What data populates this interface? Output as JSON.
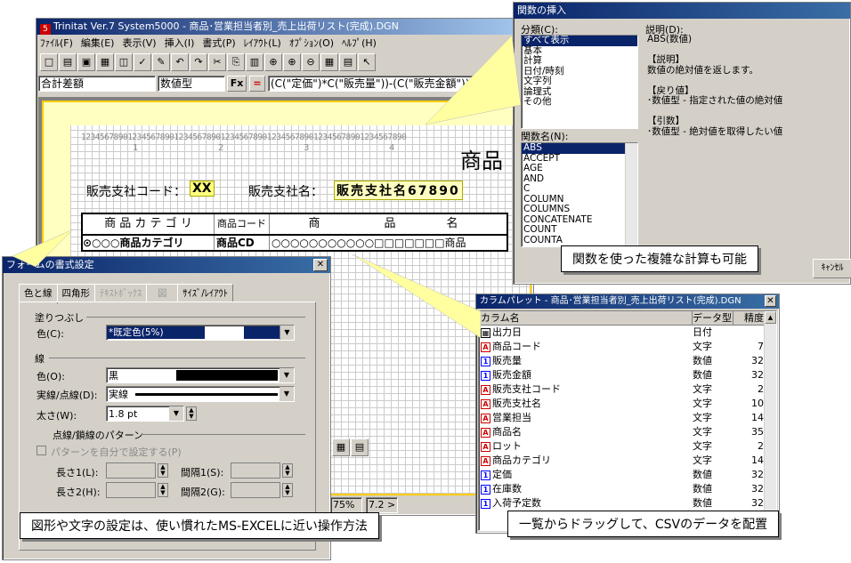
{
  "main": {
    "title": "Trinitat Ver.7 System5000 - 商品･営業担当者別_売上出荷リスト(完成).DGN",
    "menu": [
      "ﾌｧｲﾙ(F)",
      "編集(E)",
      "表示(V)",
      "挿入(I)",
      "書式(P)",
      "ﾚｲｱｳﾄ(L)",
      "ｵﾌﾟｼｮﾝ(O)",
      "ﾍﾙﾌﾟ(H)"
    ],
    "formula_name": "合計差額",
    "formula_type": "数値型",
    "fx": "Fx",
    "eq": "=",
    "formula": "(C(\"定価\")*C(\"販売量\"))-(C(\"販売金額\"))",
    "ruler": "1234567890123456789012345678901234567890123456789012345678901234567890",
    "ruler_nums": [
      "1",
      "2",
      "3",
      "4"
    ],
    "report_title": "商品",
    "seller_code_label": "販売支社コード：",
    "seller_code_value": "XX",
    "seller_name_label": "販売支社名：",
    "seller_name_value": "販売支社名67890",
    "headers": [
      "商 品 カ テ ゴ リ",
      "商品コード",
      "商",
      "品",
      "名"
    ],
    "row": [
      "⊙○○○商品カテゴリ",
      "商品CD",
      "○○○○○○○○○○○□□□□□□□商品"
    ],
    "zoom": "75%",
    "zoom2": "7.2 >"
  },
  "func": {
    "title": "関数の挿入",
    "category_label": "分類(C):",
    "categories": [
      "すべて表示",
      "基本",
      "計算",
      "日付/時刻",
      "文字列",
      "論理式",
      "その他"
    ],
    "desc_label": "説明(D):",
    "desc_lines": [
      "ABS(数値)",
      "",
      "【説明】",
      "数値の絶対値を返します。",
      "",
      "【戻り値】",
      "･数値型 - 指定された値の絶対値",
      "",
      "【引数】",
      "･数値型 - 絶対値を取得したい値"
    ],
    "name_label": "関数名(N):",
    "names": [
      "ABS",
      "ACCEPT",
      "AGE",
      "AND",
      "C",
      "COLUMN",
      "COLUMNS",
      "CONCATENATE",
      "COUNT",
      "COUNTA"
    ],
    "cancel": "ｷｬﾝｾﾙ"
  },
  "format": {
    "title": "フォームの書式設定",
    "tabs": [
      "色と線",
      "四角形",
      "ﾃｷｽﾄﾎﾞｯｸｽ",
      "図",
      "ｻｲｽﾞ/ﾚｲｱｳﾄ"
    ],
    "fill_group": "塗りつぶし",
    "fill_color_label": "色(C):",
    "fill_color_value": "*既定色(5%)",
    "line_group": "線",
    "line_color_label": "色(O):",
    "line_color_value": "黒",
    "line_style_label": "実線/点線(D):",
    "line_style_value": "実線",
    "width_label": "太さ(W):",
    "width_value": "1.8 pt",
    "dash_group": "点線/鎖線のパターン",
    "custom_label": "パターンを自分で設定する(P)",
    "len1": "長さ1(L):",
    "gap1": "間隔1(S):",
    "len2": "長さ2(H):",
    "gap2": "間隔2(G):"
  },
  "palette": {
    "title": "カラムパレット - 商品･営業担当者別_売上出荷リスト(完成).DGN",
    "headers": [
      "カラム名",
      "データ型",
      "精度"
    ],
    "rows": [
      {
        "icon": "date",
        "name": "出力日",
        "type": "日付",
        "prec": ""
      },
      {
        "icon": "A",
        "name": "商品コード",
        "type": "文字",
        "prec": "7"
      },
      {
        "icon": "1",
        "name": "販売量",
        "type": "数値",
        "prec": "32"
      },
      {
        "icon": "1",
        "name": "販売金額",
        "type": "数値",
        "prec": "32"
      },
      {
        "icon": "A",
        "name": "販売支社コード",
        "type": "文字",
        "prec": "2"
      },
      {
        "icon": "A",
        "name": "販売支社名",
        "type": "文字",
        "prec": "10"
      },
      {
        "icon": "A",
        "name": "営業担当",
        "type": "文字",
        "prec": "14"
      },
      {
        "icon": "A",
        "name": "商品名",
        "type": "文字",
        "prec": "35"
      },
      {
        "icon": "A",
        "name": "ロット",
        "type": "文字",
        "prec": "2"
      },
      {
        "icon": "A",
        "name": "商品カテゴリ",
        "type": "文字",
        "prec": "14"
      },
      {
        "icon": "1",
        "name": "定価",
        "type": "数値",
        "prec": "32"
      },
      {
        "icon": "1",
        "name": "在庫数",
        "type": "数値",
        "prec": "32"
      },
      {
        "icon": "1",
        "name": "入荷予定数",
        "type": "数値",
        "prec": "32"
      }
    ]
  },
  "callouts": {
    "func": "関数を使った複雑な計算も可能",
    "excel": "図形や文字の設定は、使い慣れたMS-EXCELに近い操作方法",
    "csv": "一覧からドラッグして、CSVのデータを配置"
  }
}
